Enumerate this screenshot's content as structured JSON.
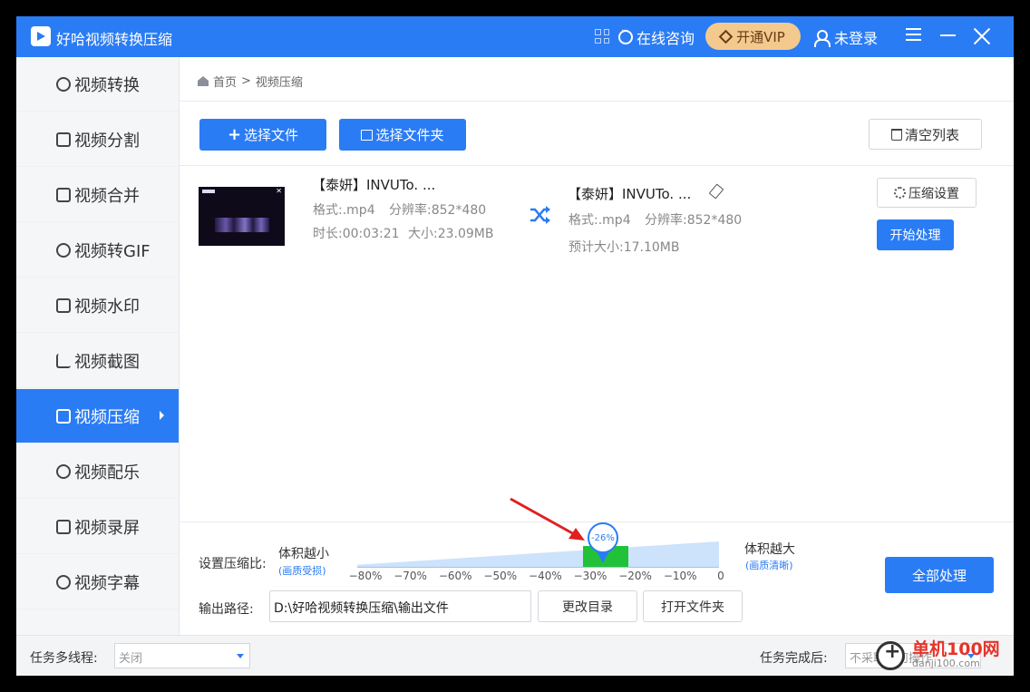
{
  "app": {
    "title": "好哈视频转换压缩"
  },
  "titlebar": {
    "consult": "在线咨询",
    "vip": "开通VIP",
    "login": "未登录"
  },
  "sidebar": {
    "items": [
      {
        "label": "视频转换",
        "icon": "convert-icon"
      },
      {
        "label": "视频分割",
        "icon": "split-icon"
      },
      {
        "label": "视频合并",
        "icon": "merge-icon"
      },
      {
        "label": "视频转GIF",
        "icon": "gif-icon"
      },
      {
        "label": "视频水印",
        "icon": "watermark-stamp-icon"
      },
      {
        "label": "视频截图",
        "icon": "crop-icon"
      },
      {
        "label": "视频压缩",
        "icon": "compress-icon",
        "active": true
      },
      {
        "label": "视频配乐",
        "icon": "music-icon"
      },
      {
        "label": "视频录屏",
        "icon": "screen-record-icon"
      },
      {
        "label": "视频字幕",
        "icon": "subtitle-icon"
      }
    ]
  },
  "breadcrumb": {
    "home": "首页",
    "sep": ">",
    "current": "视频压缩"
  },
  "toolbar": {
    "select_file": "选择文件",
    "select_folder": "选择文件夹",
    "clear_list": "清空列表"
  },
  "file": {
    "source": {
      "name": "【泰妍】INVUTo. ...",
      "format": "格式:.mp4",
      "resolution": "分辨率:852*480",
      "duration": "时长:00:03:21",
      "size": "大小:23.09MB"
    },
    "target": {
      "name": "【泰妍】INVUTo. ...",
      "format": "格式:.mp4",
      "resolution": "分辨率:852*480",
      "estimated": "预计大小:17.10MB"
    },
    "compress_settings": "压缩设置",
    "start": "开始处理"
  },
  "compression": {
    "label": "设置压缩比:",
    "small_label": "体积越小",
    "small_hint": "(画质受损)",
    "large_label": "体积越大",
    "large_hint": "(画质清晰)",
    "ticks": [
      "−80%",
      "−70%",
      "−60%",
      "−50%",
      "−40%",
      "−30%",
      "−20%",
      "−10%",
      "0"
    ],
    "value_label": "-26%",
    "value": -26
  },
  "output": {
    "label": "输出路径:",
    "path": "D:\\好哈视频转换压缩\\输出文件",
    "change_dir": "更改目录",
    "open_folder": "打开文件夹"
  },
  "process_all": "全部处理",
  "footer": {
    "threads_label": "任务多线程:",
    "threads_value": "关闭",
    "after_label": "任务完成后:",
    "after_value": "不采取任何操作"
  },
  "watermark": {
    "brand": "单机100网",
    "site": "danji100.com"
  },
  "colors": {
    "accent": "#2a7cf5",
    "vip": "#f3c98e",
    "slider_fill": "#21c23a",
    "arrow": "#e02020"
  }
}
